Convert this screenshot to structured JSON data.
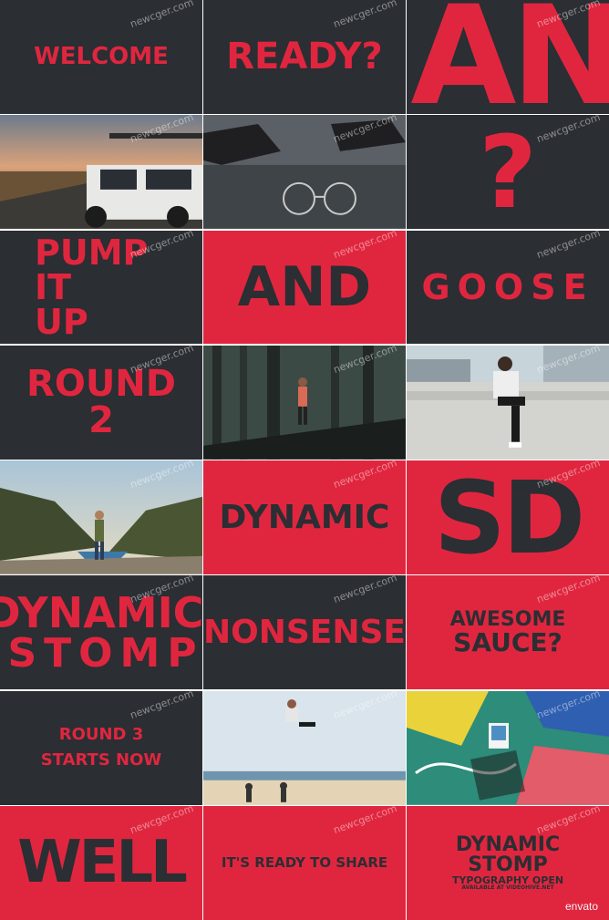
{
  "watermark": "newcger.com",
  "tiles": {
    "welcome": "WELCOME",
    "ready": "READY?",
    "big_an": "AN",
    "question": "?",
    "pump_it_up": [
      "PUMP",
      "IT",
      "UP"
    ],
    "and": "AND",
    "goose": "GOOSE",
    "round_2": [
      "ROUND",
      "2"
    ],
    "dynamic": "DYNAMIC",
    "sd": "SD",
    "dynamic_stomp": [
      "DYNAMIC",
      "STOMP"
    ],
    "nonsense": "NONSENSE",
    "awesome_sauce": [
      "AWESOME",
      "SAUCE?"
    ],
    "round_3": [
      "ROUND 3",
      "STARTS NOW"
    ],
    "well": "WELL",
    "ready_to_share": "IT'S READY TO SHARE",
    "final_title": [
      "DYNAMIC",
      "STOMP",
      "TYPOGRAPHY OPEN",
      "AVAILABLE AT VIDEOHIVE.NET"
    ],
    "envato": "envato"
  },
  "colors": {
    "red": "#e0263f",
    "dark": "#2b2e33"
  }
}
